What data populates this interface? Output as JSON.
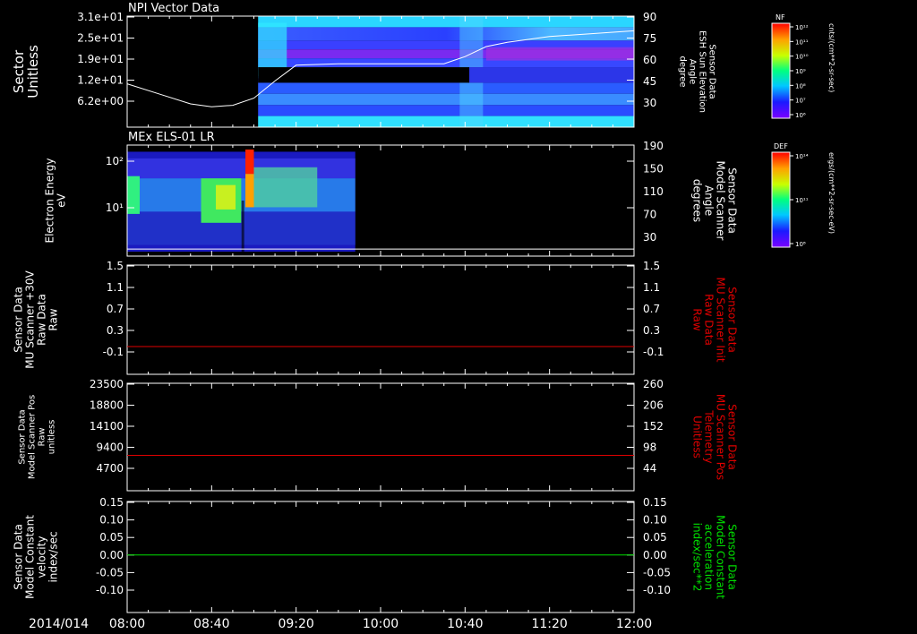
{
  "date_label": "2014/014",
  "time_ticks": [
    "08:00",
    "08:40",
    "09:20",
    "10:00",
    "10:40",
    "11:20",
    "12:00"
  ],
  "colors": {
    "axis": "#ffffff",
    "background": "#000000",
    "red_trace": "#e00000",
    "green_trace": "#00e000",
    "white_trace": "#ffffff"
  },
  "colorbars": [
    {
      "title": "NF",
      "unit": "cnts/(cm**2-sr-sec)",
      "ticks": [
        "10¹²",
        "10¹¹",
        "10¹⁰",
        "10⁹",
        "10⁸",
        "10⁷",
        "10⁶"
      ]
    },
    {
      "title": "DEF",
      "unit": "ergs/(cm**2-sr-sec-eV)",
      "ticks": [
        "10¹⁴",
        "10¹¹",
        "10⁸"
      ]
    }
  ],
  "chart_data": [
    {
      "type": "heatmap",
      "title": "NPI Vector Data",
      "ylabel": "Sector\nUnitless",
      "y_ticks": [
        "3.1e+01",
        "2.5e+01",
        "1.9e+01",
        "1.2e+01",
        "6.2e+00"
      ],
      "right_label": "Sensor Data\nESH Sun Elevation\nAngle\ndegree",
      "right_ticks": [
        "90",
        "75",
        "60",
        "45",
        "30"
      ],
      "right_ylim": [
        20,
        90
      ],
      "data_start": "09:02",
      "line_series": {
        "x": [
          "08:00",
          "08:15",
          "08:30",
          "08:40",
          "08:50",
          "09:00",
          "09:10",
          "09:20",
          "09:40",
          "10:00",
          "10:30",
          "10:40",
          "10:50",
          "11:00",
          "11:20",
          "11:40",
          "12:00"
        ],
        "values": [
          44,
          37,
          30,
          28,
          29,
          34,
          46,
          57,
          58,
          58,
          58,
          63,
          70,
          73,
          77,
          79,
          81
        ]
      }
    },
    {
      "type": "heatmap",
      "title": "MEx ELS-01 LR",
      "ylabel": "Electron Energy\neV",
      "y_ticks": [
        "10²",
        "10¹"
      ],
      "right_label": "Sensor Data\nModel Scanner\nAngle\ndegrees",
      "right_ticks": [
        "190",
        "150",
        "110",
        "70",
        "30"
      ],
      "right_ylim": [
        0,
        190
      ],
      "data_range": [
        "08:00",
        "09:48"
      ],
      "burst": [
        "08:56",
        "09:00"
      ],
      "line_series": {
        "x": [
          "08:00",
          "12:00"
        ],
        "values": [
          12,
          12
        ]
      }
    },
    {
      "type": "line",
      "ylabel": "Sensor Data\nMU Scanner +30V\nRaw Data\nRaw",
      "y_ticks": [
        "1.5",
        "1.1",
        "0.7",
        "0.3",
        "-0.1"
      ],
      "ylim": [
        -0.3,
        1.5
      ],
      "right_label": "Sensor Data\nMU Scanner Init\nRaw Data\nRaw",
      "right_ticks": [
        "1.5",
        "1.1",
        "0.7",
        "0.3",
        "-0.1"
      ],
      "right_color": "red",
      "series": [
        {
          "x": [
            "08:00",
            "12:00"
          ],
          "values": [
            0,
            0
          ]
        }
      ]
    },
    {
      "type": "line",
      "ylabel": "Sensor Data\nModel Scanner Pos\nRaw\nunitless",
      "y_ticks": [
        "23500",
        "18800",
        "14100",
        "9400",
        "4700"
      ],
      "ylim": [
        0,
        23500
      ],
      "right_label": "Sensor Data\nMU Scanner Pos\nTelemetry\nUnitless",
      "right_ticks": [
        "260",
        "206",
        "152",
        "98",
        "44"
      ],
      "right_color": "red",
      "series": [
        {
          "x": [
            "08:00",
            "12:00"
          ],
          "values": [
            7600,
            7600
          ]
        }
      ]
    },
    {
      "type": "line",
      "ylabel": "Sensor Data\nModel Constant\nvelocity\nindex/sec",
      "y_ticks": [
        "0.15",
        "0.10",
        "0.05",
        "0.00",
        "-0.05",
        "-0.10"
      ],
      "ylim": [
        -0.1,
        0.15
      ],
      "right_label": "Sensor Data\nModel Constant\nacceleration\nindex/sec**2",
      "right_ticks": [
        "0.15",
        "0.10",
        "0.05",
        "0.00",
        "-0.05",
        "-0.10"
      ],
      "right_color": "green",
      "series": [
        {
          "x": [
            "08:00",
            "12:00"
          ],
          "values": [
            0,
            0
          ]
        }
      ]
    }
  ]
}
